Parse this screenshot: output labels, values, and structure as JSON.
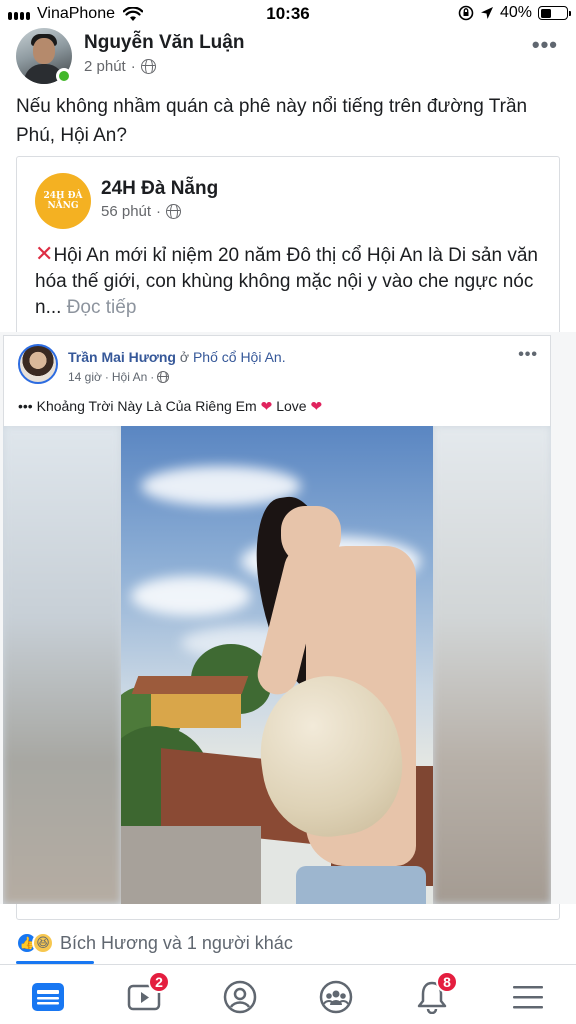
{
  "status_bar": {
    "carrier": "VinaPhone",
    "time": "10:36",
    "battery_percent": "40%",
    "battery_level": 0.4
  },
  "post": {
    "author": "Nguyễn Văn Luận",
    "time": "2 phút",
    "privacy_icon": "globe-icon",
    "text": "Nếu không nhầm quán cà phê này nổi tiếng trên đường Trần Phú, Hội An?"
  },
  "shared": {
    "page_logo_text": "24H ĐÀ NẴNG",
    "page_name": "24H Đà Nẵng",
    "time": "56 phút",
    "text": "Hội An mới kỉ niệm 20 năm Đô thị cổ Hội An là Di sản văn hóa thế giới, con khùng không mặc nội y vào che ngực nóc n...",
    "see_more": "Đọc tiếp"
  },
  "embedded": {
    "name": "Trần Mai Hương",
    "at": "ở",
    "place": "Phố cổ Hội An.",
    "time": "14 giờ",
    "location": "Hội An",
    "caption_prefix": "•••",
    "caption": "Khoảng Trời Này Là Của Riêng Em",
    "caption_love": "Love"
  },
  "reactions": {
    "text": "Bích Hương và 1 người khác"
  },
  "tabs": {
    "watch_badge": "2",
    "notifications_badge": "8"
  },
  "colors": {
    "brand": "#1877f2",
    "badge": "#e41e3f",
    "online": "#42b72a"
  }
}
